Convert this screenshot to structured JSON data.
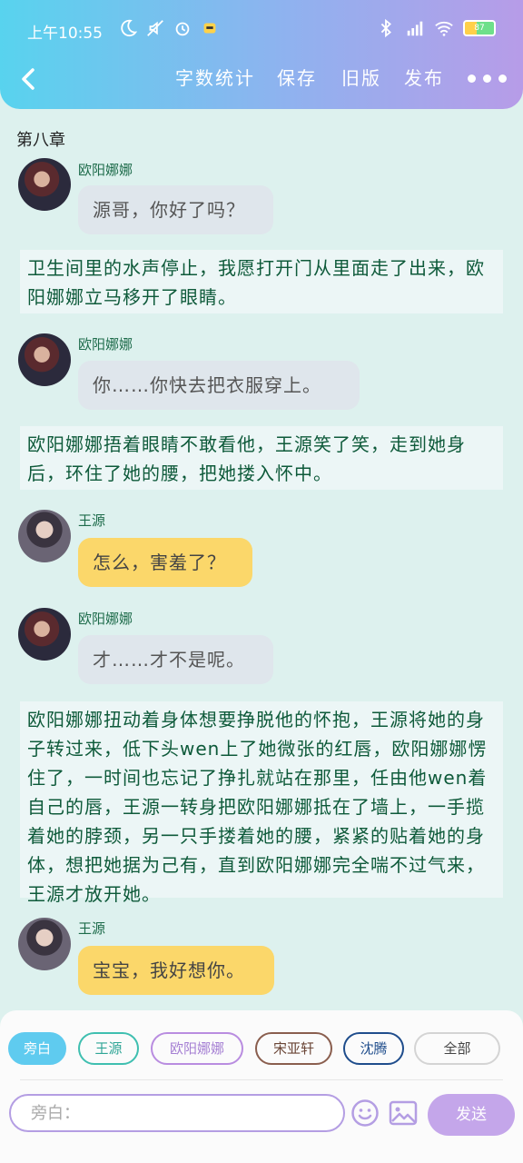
{
  "status": {
    "time": "上午10:55",
    "battery": "87"
  },
  "toolbar": {
    "word_count": "字数统计",
    "save": "保存",
    "old_version": "旧版",
    "publish": "发布"
  },
  "chapter": "第八章",
  "messages": [
    {
      "speaker": "欧阳娜娜",
      "text": "源哥，你好了吗？"
    },
    {
      "narration": "卫生间里的水声停止，我愿打开门从里面走了出来，欧阳娜娜立马移开了眼睛。"
    },
    {
      "speaker": "欧阳娜娜",
      "text": "你……你快去把衣服穿上。"
    },
    {
      "narration": "欧阳娜娜捂着眼睛不敢看他，王源笑了笑，走到她身后，环住了她的腰，把她搂入怀中。"
    },
    {
      "speaker": "王源",
      "text": "怎么，害羞了？"
    },
    {
      "speaker": "欧阳娜娜",
      "text": "才……才不是呢。"
    },
    {
      "narration": "欧阳娜娜扭动着身体想要挣脱他的怀抱，王源将她的身子转过来，低下头wen上了她微张的红唇，欧阳娜娜愣住了，一时间也忘记了挣扎就站在那里，任由他wen着自己的唇，王源一转身把欧阳娜娜抵在了墙上，一手揽着她的脖颈，另一只手搂着她的腰，紧紧的贴着她的身体，想把她据为己有，直到欧阳娜娜完全喘不过气来，王源才放开她。"
    },
    {
      "speaker": "王源",
      "text": "宝宝，我好想你。"
    }
  ],
  "roles": [
    "旁白",
    "王源",
    "欧阳娜娜",
    "宋亚轩",
    "沈腾",
    "全部"
  ],
  "input": {
    "placeholder": "旁白："
  },
  "send": "发送",
  "colors": {
    "ou_bubble": "#dfe6ec",
    "wang_bubble": "#fbd76a",
    "accent": "#b49ee3"
  }
}
